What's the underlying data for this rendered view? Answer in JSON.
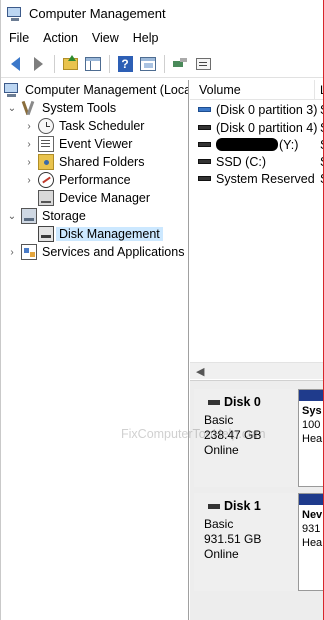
{
  "window": {
    "title": "Computer Management"
  },
  "menu": [
    "File",
    "Action",
    "View",
    "Help"
  ],
  "tree": {
    "root": "Computer Management (Local",
    "items": [
      {
        "label": "System Tools",
        "icon": "tools-icon"
      },
      {
        "label": "Task Scheduler",
        "icon": "clock-icon"
      },
      {
        "label": "Event Viewer",
        "icon": "event-viewer-icon"
      },
      {
        "label": "Shared Folders",
        "icon": "shared-folder-icon"
      },
      {
        "label": "Performance",
        "icon": "performance-icon"
      },
      {
        "label": "Device Manager",
        "icon": "device-manager-icon"
      },
      {
        "label": "Storage",
        "icon": "storage-icon"
      },
      {
        "label": "Disk Management",
        "icon": "disk-icon"
      },
      {
        "label": "Services and Applications",
        "icon": "services-icon"
      }
    ]
  },
  "volume_list": {
    "header": "Volume",
    "header2": "L",
    "rows": [
      {
        "name": "(Disk 0 partition 3)",
        "s": "S"
      },
      {
        "name": "(Disk 0 partition 4)",
        "s": "S"
      },
      {
        "name": "(Y:)",
        "s": "S"
      },
      {
        "name": "SSD (C:)",
        "s": "S"
      },
      {
        "name": "System Reserved",
        "s": "S"
      }
    ]
  },
  "disks": [
    {
      "name": "Disk 0",
      "type": "Basic",
      "size": "238.47 GB",
      "status": "Online",
      "partition": [
        "Sys",
        "100",
        "Hea"
      ]
    },
    {
      "name": "Disk 1",
      "type": "Basic",
      "size": "931.51 GB",
      "status": "Online",
      "partition": [
        "Nev",
        "931",
        "Hea"
      ]
    }
  ],
  "watermark": "FixComputerTooHelp.com",
  "colors": {
    "partition_cap": "#1f3b8c",
    "selected": "#cce8ff",
    "border_red": "#d7262b"
  }
}
